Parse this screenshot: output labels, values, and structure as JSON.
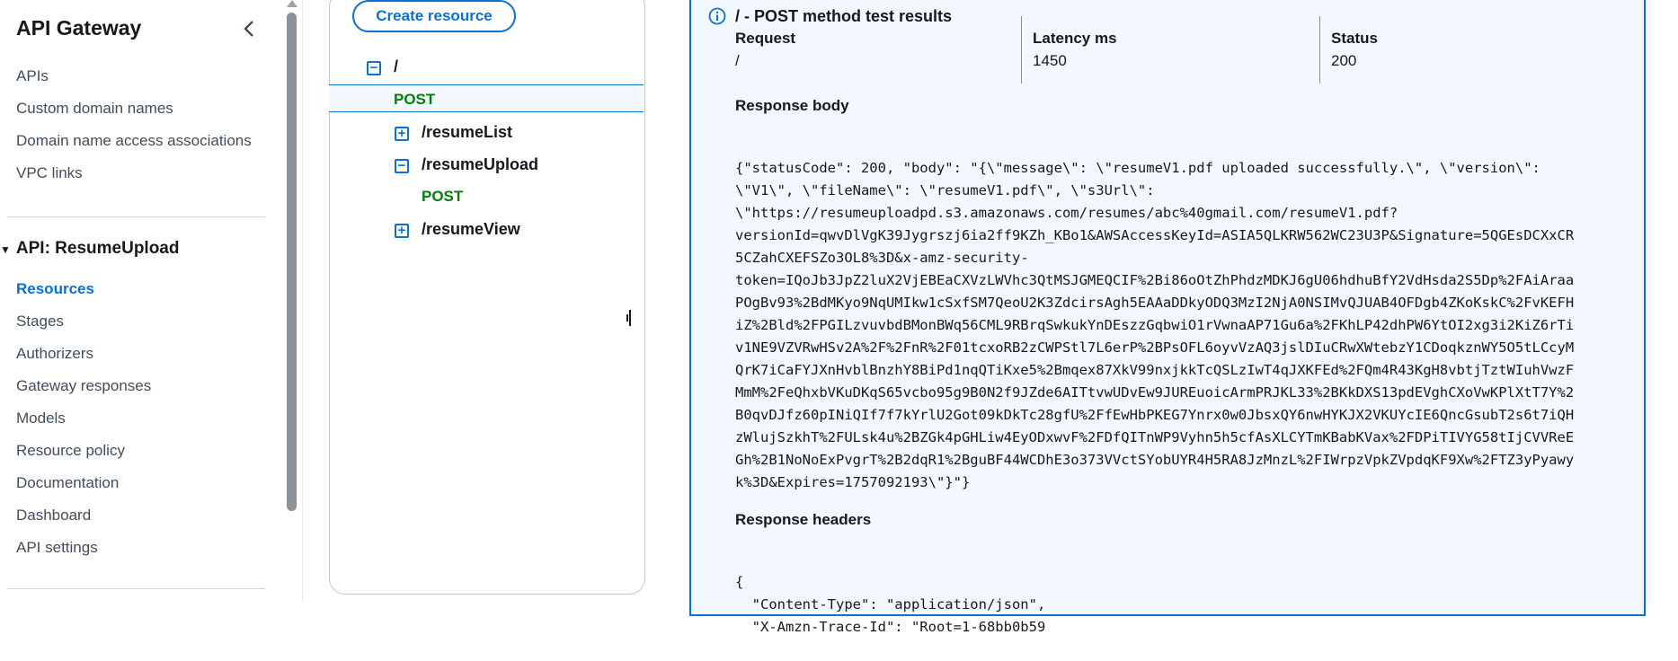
{
  "sidebar": {
    "title": "API Gateway",
    "top_items": [
      "APIs",
      "Custom domain names",
      "Domain name access associations",
      "VPC links"
    ],
    "api_section_label": "API: ResumeUpload",
    "api_items": [
      "Resources",
      "Stages",
      "Authorizers",
      "Gateway responses",
      "Models",
      "Resource policy",
      "Documentation",
      "Dashboard",
      "API settings"
    ],
    "active_item": "Resources"
  },
  "resources": {
    "create_button": "Create resource",
    "tree": [
      {
        "path": "/",
        "expanded": true,
        "methods": [
          "POST"
        ]
      },
      {
        "path": "/resumeList",
        "expanded": false
      },
      {
        "path": "/resumeUpload",
        "expanded": true,
        "methods": [
          "POST"
        ]
      },
      {
        "path": "/resumeView",
        "expanded": false
      }
    ],
    "expand_symbol": "+",
    "collapse_symbol": "−"
  },
  "results": {
    "title": "/ - POST method test results",
    "request_label": "Request",
    "request_value": "/",
    "latency_label": "Latency ms",
    "latency_value": "1450",
    "status_label": "Status",
    "status_value": "200",
    "response_body_label": "Response body",
    "response_body_lines": [
      "{\"statusCode\": 200, \"body\": \"{\\\"message\\\": \\\"resumeV1.pdf uploaded successfully.\\\", \\\"version\\\":",
      "\\\"V1\\\", \\\"fileName\\\": \\\"resumeV1.pdf\\\", \\\"s3Url\\\":",
      "\\\"https://resumeuploadpd.s3.amazonaws.com/resumes/abc%40gmail.com/resumeV1.pdf?",
      "versionId=qwvDlVgK39Jygrszj6ia2ff9KZh_KBo1&AWSAccessKeyId=ASIA5QLKRW562WC23U3P&Signature=5QGEsDCXxCR",
      "5CZahCXEFSZo3OL8%3D&x-amz-security-",
      "token=IQoJb3JpZ2luX2VjEBEaCXVzLWVhc3QtMSJGMEQCIF%2Bi86oOtZhPhdzMDKJ6gU06hdhuBfY2VdHsda2S5Dp%2FAiAraa",
      "POgBv93%2BdMKyo9NqUMIkw1cSxfSM7QeoU2K3ZdcirsAgh5EAAaDDkyODQ3MzI2NjA0NSIMvQJUAB4OFDgb4ZKoKskC%2FvKEFH",
      "iZ%2Bld%2FPGILzvuvbdBMonBWq56CML9RBrqSwkukYnDEszzGqbwiO1rVwnaAP71Gu6a%2FKhLP42dhPW6YtOI2xg3i2KiZ6rTi",
      "v1NE9VZVRwHSv2A%2F%2FnR%2F01tcxoRB2zCWPStl7L6erP%2BPsOFL6oyvVzAQ3jslDIuCRwXWtebzY1CDoqkznWY5O5tLCcyM",
      "QrK7iCaFYJXnHvblBnzhY8BiPd1nqQTiKxe5%2Bmqex87XkV99nxjkkTcQSLzIwT4qJXKFEd%2FQm4R43KgH8vbtjTztWIuhVwzF",
      "MmM%2FeQhxbVKuDKqS65vcbo95g9B0N2f9JZde6AITtvwUDvEw9JUREuoicArmPRJKL33%2BKkDXS13pdEVghCXoVwKPlXtT7Y%2",
      "B0qvDJfz60pINiQIf7f7kYrlU2Got09kDkTc28gfU%2FfEwHbPKEG7Ynrx0w0JbsxQY6nwHYKJX2VKUYcIE6QncGsubT2s6t7iQH",
      "zWlujSzkhT%2FULsk4u%2BZGk4pGHLiw4EyODxwvF%2FDfQITnWP9Vyhn5h5cfAsXLCYTmKBabKVax%2FDPiTIVYG58tIjCVVReE",
      "Gh%2B1NoNoExPvgrT%2B2dqR1%2BguBF44WCDhE3o373VVctSYobUYR4H5RA8JzMnzL%2FIWrpzVpkZVpdqKF9Xw%2FTZ3yPyawy",
      "k%3D&Expires=1757092193\\\"}\"}"
    ],
    "response_headers_label": "Response headers",
    "response_headers_lines": [
      "{",
      "  \"Content-Type\": \"application/json\",",
      "  \"X-Amzn-Trace-Id\": \"Root=1-68bb0b59"
    ]
  },
  "colors": {
    "accent": "#0972d3",
    "post_method": "#037f0c",
    "panel_bg": "#f2f8fd"
  },
  "icons": [
    "chevron-left-icon",
    "expand-icon",
    "collapse-icon",
    "info-icon"
  ]
}
